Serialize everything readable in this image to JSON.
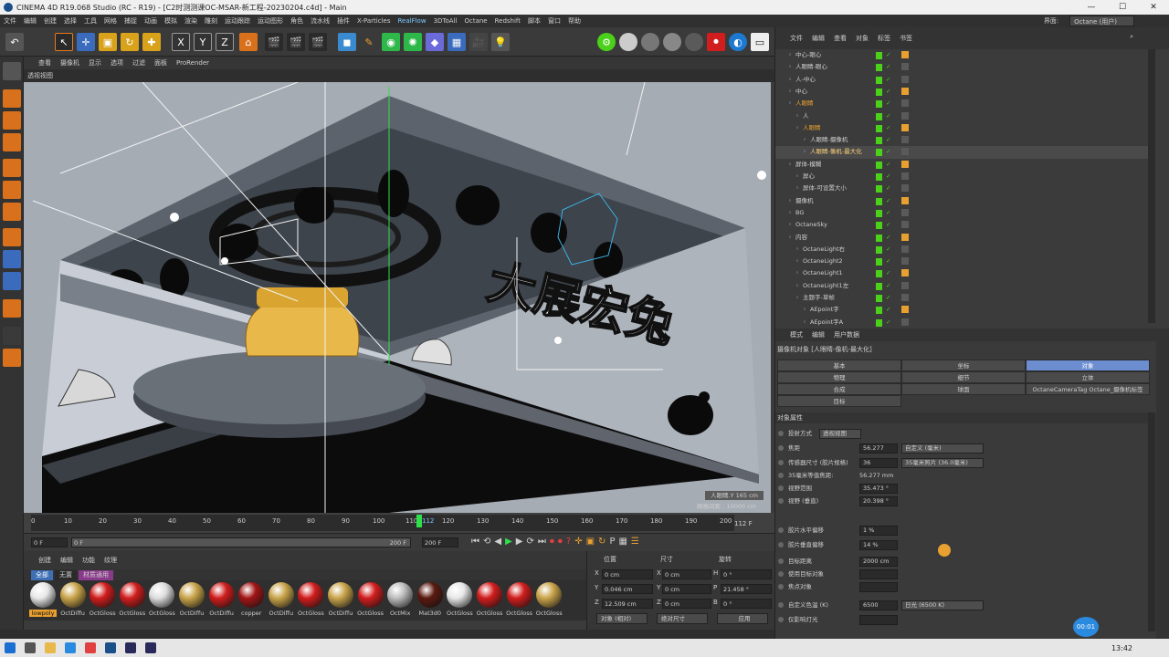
{
  "window": {
    "title": "CINEMA 4D R19.068 Studio (RC - R19) - [C2时测测课OC-MSAR-新工程-20230204.c4d] - Main"
  },
  "menubar": {
    "items": [
      "文件",
      "编辑",
      "创建",
      "选择",
      "工具",
      "网格",
      "捕捉",
      "动画",
      "模拟",
      "渲染",
      "雕刻",
      "运动跟踪",
      "运动图形",
      "角色",
      "流水线",
      "插件",
      "X-Particles",
      "RealFlow",
      "3DToAll",
      "Octane",
      "Redshift",
      "脚本",
      "窗口",
      "帮助"
    ],
    "layout_label": "界面:",
    "layout_value": "Octane (用户)"
  },
  "viewport": {
    "menu": [
      "查看",
      "摄像机",
      "显示",
      "选项",
      "过滤",
      "面板",
      "ProRender"
    ],
    "label": "透视视图",
    "camera_info": "人眼睛.Y    165 cm",
    "grid_info": "网格间距 : 10000 cm",
    "scene_text": "大展宏兔",
    "colors": {
      "accent": "#4bd11a",
      "gold": "#e8b84a"
    }
  },
  "timeline": {
    "ticks": [
      "0",
      "10",
      "20",
      "30",
      "40",
      "50",
      "60",
      "70",
      "80",
      "90",
      "100",
      "110",
      "112",
      "120",
      "130",
      "140",
      "150",
      "160",
      "170",
      "180",
      "190",
      "200"
    ],
    "current_frame": "112 F",
    "playhead_frame": 112
  },
  "transport": {
    "start": "0 F",
    "start2": "0 F",
    "end": "200 F",
    "end2": "200 F"
  },
  "materials": {
    "tabs": [
      "创建",
      "编辑",
      "功能",
      "纹理"
    ],
    "filters": [
      "全部",
      "无置",
      "材质通用"
    ],
    "active_filter": "材质通用",
    "items": [
      {
        "name": "lowpoly",
        "color": "#e8e8e8",
        "selected": true
      },
      {
        "name": "OctDiffu",
        "color": "#c9a44a"
      },
      {
        "name": "OctGloss",
        "color": "#d11d1d"
      },
      {
        "name": "OctGloss",
        "color": "#d11d1d"
      },
      {
        "name": "OctGloss",
        "color": "#dddddd"
      },
      {
        "name": "OctDiffu",
        "color": "#c9a44a"
      },
      {
        "name": "OctDiffu",
        "color": "#d11d1d"
      },
      {
        "name": "copper",
        "color": "#a31515"
      },
      {
        "name": "OctDiffu",
        "color": "#c9a44a"
      },
      {
        "name": "OctGloss",
        "color": "#d11d1d"
      },
      {
        "name": "OctDiffu",
        "color": "#c9a44a"
      },
      {
        "name": "OctGloss",
        "color": "#d11d1d"
      },
      {
        "name": "OctMix",
        "color": "#bdbdbd"
      },
      {
        "name": "Mat3d0",
        "color": "#5a1a10"
      },
      {
        "name": "OctGloss",
        "color": "#e8e8e8"
      },
      {
        "name": "OctGloss",
        "color": "#d11d1d"
      },
      {
        "name": "OctGloss",
        "color": "#d11d1d"
      },
      {
        "name": "OctGloss",
        "color": "#c9a44a"
      }
    ]
  },
  "coords": {
    "headers": [
      "位置",
      "尺寸",
      "旋转"
    ],
    "rows": [
      {
        "axis": "X",
        "pos": "0 cm",
        "axis2": "X",
        "size": "0 cm",
        "rot_axis": "H",
        "rot": "0 °"
      },
      {
        "axis": "Y",
        "pos": "0.046 cm",
        "axis2": "Y",
        "size": "0 cm",
        "rot_axis": "P",
        "rot": "21.458 °"
      },
      {
        "axis": "Z",
        "pos": "12.509 cm",
        "axis2": "Z",
        "size": "0 cm",
        "rot_axis": "B",
        "rot": "0 °"
      }
    ],
    "mode1": "对象 (相对)",
    "mode2": "绝对尺寸",
    "apply": "应用"
  },
  "objects": {
    "menu": [
      "文件",
      "编辑",
      "查看",
      "对象",
      "标签",
      "书签"
    ],
    "rows": [
      {
        "name": "中心-眼心",
        "indent": 0
      },
      {
        "name": "人眼睛-眼心",
        "indent": 0
      },
      {
        "name": "人-中心",
        "indent": 0
      },
      {
        "name": "中心",
        "indent": 0
      },
      {
        "name": "人眼睛",
        "indent": 0,
        "highlight": true
      },
      {
        "name": "人",
        "indent": 1
      },
      {
        "name": "人眼睛",
        "indent": 1,
        "highlight": true
      },
      {
        "name": "人眼睛-摄像机",
        "indent": 2
      },
      {
        "name": "人眼睛-像机-最大化",
        "indent": 2,
        "active": true
      },
      {
        "name": "屏体-模糊",
        "indent": 0
      },
      {
        "name": "屏心",
        "indent": 1
      },
      {
        "name": "屏体-可设置大小",
        "indent": 1
      },
      {
        "name": "摄像机",
        "indent": 0
      },
      {
        "name": "BG",
        "indent": 0
      },
      {
        "name": "OctaneSky",
        "indent": 0
      },
      {
        "name": "内容",
        "indent": 0
      },
      {
        "name": "OctaneLight右",
        "indent": 1
      },
      {
        "name": "OctaneLight2",
        "indent": 1
      },
      {
        "name": "OctaneLight1",
        "indent": 1
      },
      {
        "name": "OctaneLight1左",
        "indent": 1
      },
      {
        "name": "主题字-草帧",
        "indent": 1
      },
      {
        "name": "AEpoint字",
        "indent": 2
      },
      {
        "name": "AEpoint字A",
        "indent": 2
      }
    ]
  },
  "attributes": {
    "menu": [
      "模式",
      "编辑",
      "用户数据"
    ],
    "title": "摄像机对象 [人眼睛-像机-最大化]",
    "tabs": [
      [
        "基本",
        "坐标",
        "对象"
      ],
      [
        "物理",
        "细节",
        "立体"
      ],
      [
        "合成",
        "球面",
        "OctaneCameraTag Octane_摄像机标签"
      ],
      [
        "目标"
      ]
    ],
    "active_tab": "对象",
    "section": "对象属性",
    "rows": [
      {
        "label": "投射方式",
        "value": "透视视图",
        "type": "drop"
      },
      {
        "label": "焦距",
        "value": "56.277",
        "drop": "自定义 (毫米)"
      },
      {
        "label": "传感器尺寸 (胶片规格)",
        "value": "36",
        "drop": "35毫米照片 (36.0毫米)"
      },
      {
        "label": "35毫米等值焦距:",
        "value": "56.277 mm",
        "type": "text"
      },
      {
        "label": "视野范围",
        "value": "35.473 °"
      },
      {
        "label": "视野 (垂直)",
        "value": "20.398 °"
      },
      {
        "label": "胶片水平偏移",
        "value": "1 %"
      },
      {
        "label": "胶片垂直偏移",
        "value": "14 %"
      },
      {
        "label": "目标距离",
        "value": "2000 cm"
      },
      {
        "label": "使用目标对象",
        "value": ""
      },
      {
        "label": "焦点对象",
        "value": ""
      },
      {
        "label": "自定义色温 (K)",
        "value": "6500",
        "drop": "日光 (6500 K)"
      },
      {
        "label": "仅影响灯光",
        "value": ""
      }
    ]
  },
  "recorder": {
    "time": "00:01"
  },
  "taskbar": {
    "clock": "13:42"
  }
}
